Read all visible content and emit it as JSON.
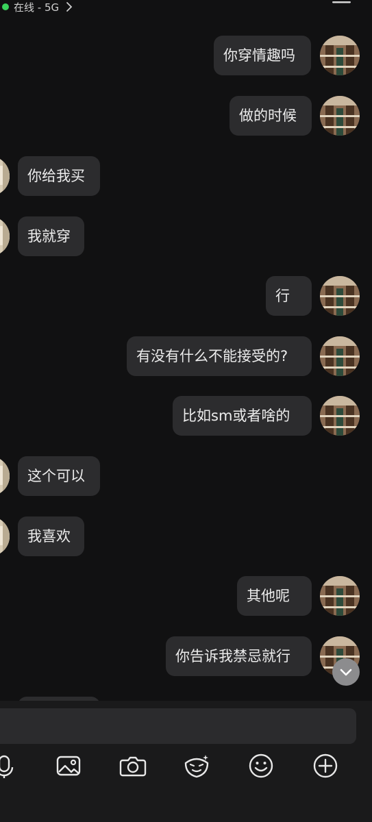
{
  "status": {
    "presence_text": "在线 - 5G",
    "presence_color": "#39d25b"
  },
  "messages": [
    {
      "side": "right",
      "text": "你穿情趣吗"
    },
    {
      "side": "right",
      "text": "做的时候"
    },
    {
      "side": "left",
      "text": "你给我买"
    },
    {
      "side": "left",
      "text": "我就穿"
    },
    {
      "side": "right",
      "text": "行"
    },
    {
      "side": "right",
      "text": "有没有什么不能接受的?"
    },
    {
      "side": "right",
      "text": "比如sm或者啥的"
    },
    {
      "side": "left",
      "text": "这个可以"
    },
    {
      "side": "left",
      "text": "我喜欢"
    },
    {
      "side": "right",
      "text": "其他呢"
    },
    {
      "side": "right",
      "text": "你告诉我禁忌就行"
    }
  ],
  "composer": {
    "input_value": "",
    "toolbar": [
      "voice-icon",
      "image-icon",
      "camera-icon",
      "sticker-icon",
      "emoji-icon",
      "add-icon"
    ]
  },
  "colors": {
    "background": "#111112",
    "bubble": "#2c2c2e",
    "text": "#ececec"
  }
}
